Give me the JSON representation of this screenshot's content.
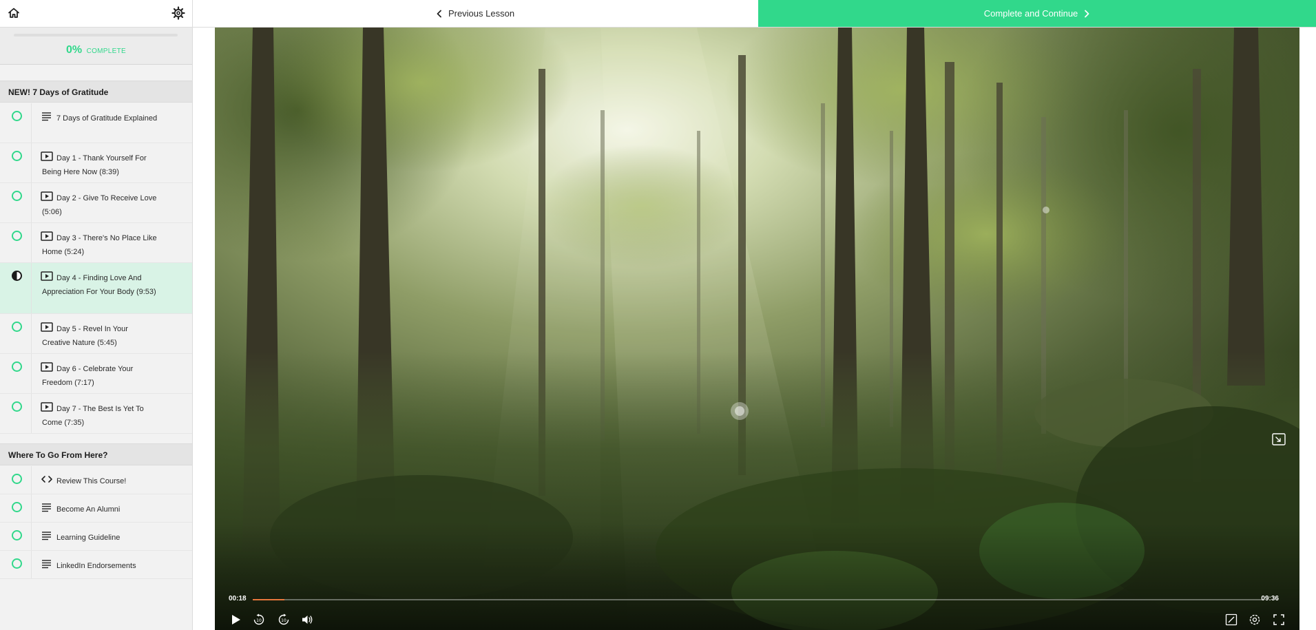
{
  "progress": {
    "percent_text": "0%",
    "label": "COMPLETE",
    "fraction": 0
  },
  "nav": {
    "previous_label": "Previous Lesson",
    "complete_label": "Complete and Continue"
  },
  "sections": [
    {
      "title": "NEW! 7 Days of Gratitude",
      "lessons": [
        {
          "type": "text",
          "title": "7 Days of Gratitude Explained",
          "status": "incomplete"
        },
        {
          "type": "video",
          "title": "Day 1 - Thank Yourself For Being Here Now (8:39)",
          "status": "incomplete"
        },
        {
          "type": "video",
          "title": "Day 2 - Give To Receive Love (5:06)",
          "status": "incomplete"
        },
        {
          "type": "video",
          "title": "Day 3 - There's No Place Like Home (5:24)",
          "status": "incomplete"
        },
        {
          "type": "video",
          "title": "Day 4 - Finding Love And Appreciation For Your Body (9:53)",
          "status": "in-progress"
        },
        {
          "type": "video",
          "title": "Day 5 - Revel In Your Creative Nature (5:45)",
          "status": "incomplete"
        },
        {
          "type": "video",
          "title": "Day 6 - Celebrate Your Freedom (7:17)",
          "status": "incomplete"
        },
        {
          "type": "video",
          "title": "Day 7 - The Best Is Yet To Come (7:35)",
          "status": "incomplete"
        }
      ]
    },
    {
      "title": "Where To Go From Here?",
      "lessons": [
        {
          "type": "code",
          "title": "Review This Course!",
          "status": "incomplete"
        },
        {
          "type": "text",
          "title": "Become An Alumni",
          "status": "incomplete"
        },
        {
          "type": "text",
          "title": "Learning Guideline",
          "status": "incomplete"
        },
        {
          "type": "text",
          "title": "LinkedIn Endorsements",
          "status": "incomplete"
        }
      ]
    }
  ],
  "player": {
    "current_time": "00:18",
    "total_time": "09:36",
    "played_fraction": 0.031
  },
  "colors": {
    "accent": "#31d88b",
    "scrubber": "#e8773c",
    "active_lesson_bg": "#d9f3e6"
  }
}
